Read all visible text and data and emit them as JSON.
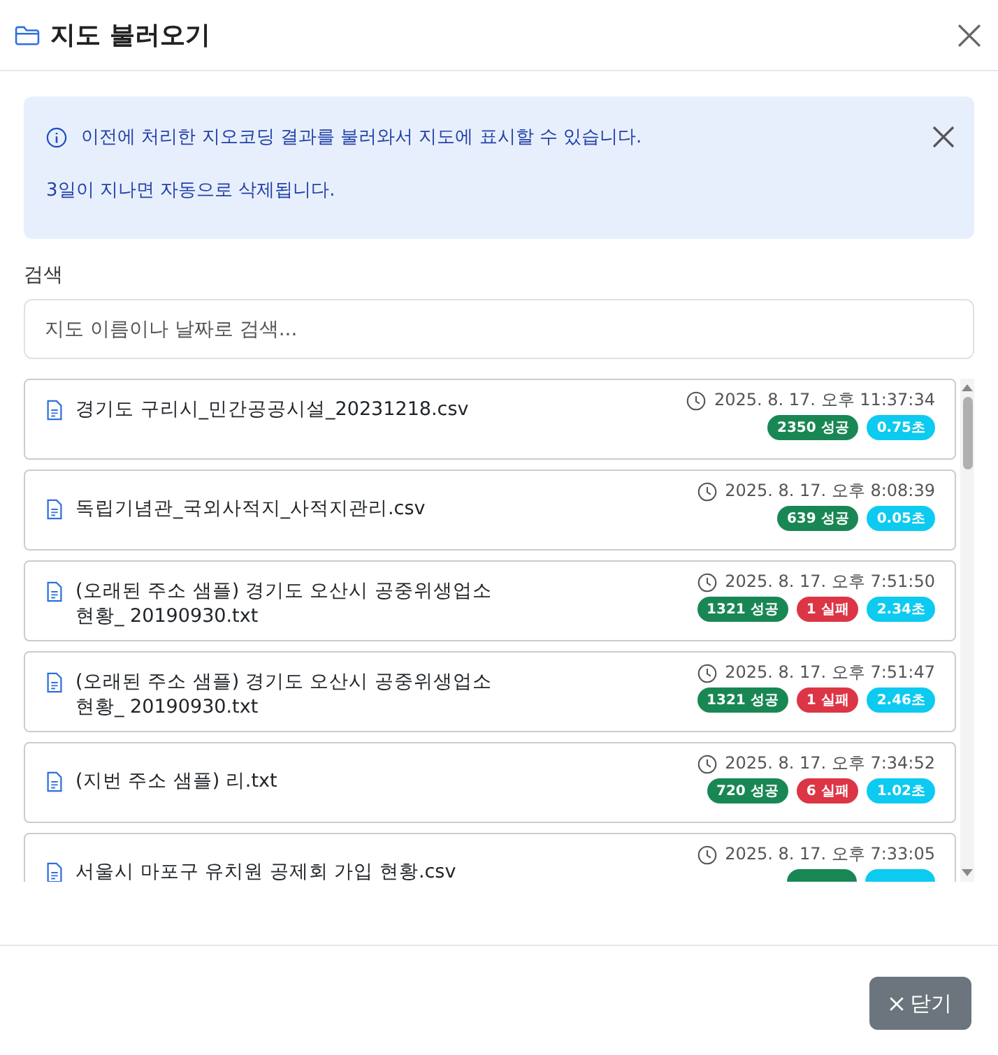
{
  "dialog": {
    "title": "지도 불러오기"
  },
  "alert": {
    "lines": [
      "이전에 처리한 지오코딩 결과를 불러와서 지도에 표시할 수 있습니다.",
      "3일이 지나면 자동으로 삭제됩니다."
    ]
  },
  "search": {
    "label": "검색",
    "placeholder": "지도 이름이나 날짜로 검색..."
  },
  "files": [
    {
      "name": "경기도 구리시_민간공공시설_20231218.csv",
      "time": "2025. 8. 17. 오후 11:37:34",
      "badges": [
        {
          "kind": "success",
          "text": "2350 성공"
        },
        {
          "kind": "duration",
          "text": "0.75초"
        }
      ]
    },
    {
      "name": "독립기념관_국외사적지_사적지관리.csv",
      "time": "2025. 8. 17. 오후 8:08:39",
      "badges": [
        {
          "kind": "success",
          "text": "639 성공"
        },
        {
          "kind": "duration",
          "text": "0.05초"
        }
      ]
    },
    {
      "name": "(오래된 주소 샘플) 경기도 오산시 공중위생업소 현황_ 20190930.txt",
      "time": "2025. 8. 17. 오후 7:51:50",
      "badges": [
        {
          "kind": "success",
          "text": "1321 성공"
        },
        {
          "kind": "failure",
          "text": "1 실패"
        },
        {
          "kind": "duration",
          "text": "2.34초"
        }
      ]
    },
    {
      "name": "(오래된 주소 샘플) 경기도 오산시 공중위생업소 현황_ 20190930.txt",
      "time": "2025. 8. 17. 오후 7:51:47",
      "badges": [
        {
          "kind": "success",
          "text": "1321 성공"
        },
        {
          "kind": "failure",
          "text": "1 실패"
        },
        {
          "kind": "duration",
          "text": "2.46초"
        }
      ]
    },
    {
      "name": "(지번 주소 샘플) 리.txt",
      "time": "2025. 8. 17. 오후 7:34:52",
      "badges": [
        {
          "kind": "success",
          "text": "720 성공"
        },
        {
          "kind": "failure",
          "text": "6 실패"
        },
        {
          "kind": "duration",
          "text": "1.02초"
        }
      ]
    },
    {
      "name": "서울시 마포구 유치원 공제회 가입 현황.csv",
      "time": "2025. 8. 17. 오후 7:33:05",
      "badges": [
        {
          "kind": "success"
        },
        {
          "kind": "duration"
        }
      ]
    }
  ],
  "footer": {
    "close_button": "닫기"
  }
}
